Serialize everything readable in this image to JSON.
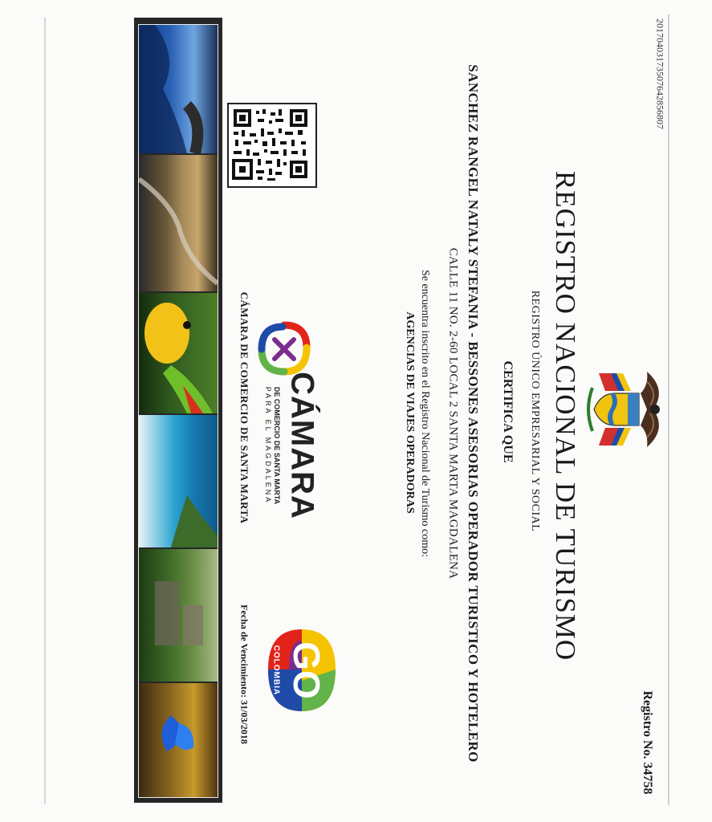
{
  "doc_id": "20170403173507642856807",
  "title": "REGISTRO NACIONAL DE TURISMO",
  "subtitle": "REGISTRO ÚNICO EMPRESARIAL Y SOCIAL",
  "certifica": "CERTIFICA QUE",
  "name": "SANCHEZ RANGEL NATALY STEFANIA - BESSONES ASESORIAS OPERADOR TURISTICO Y HOTELERO",
  "address": "CALLE 11 NO. 2-60 LOCAL 2 SANTA MARTA MAGDALENA",
  "inscrito": "Se encuentra inscrito en el Registro Nacional de Turismo como:",
  "category": "AGENCIAS DE VIAJES OPERADORAS",
  "registro": "Registro No. 34758",
  "fecha": "Fecha de Vencimiento: 31/03/2018",
  "camara": {
    "logo_word": "CÁMARA",
    "logo_sub1": "DE COMERCIO DE SANTA MARTA",
    "logo_sub2": "PARA EL MAGDALENA",
    "name": "CÁMARA DE COMERCIO DE SANTA MARTA"
  },
  "go_logo": {
    "word": "GO",
    "country": "COLOMBIA"
  },
  "icons": [
    "coat-of-arms-icon",
    "qr-code",
    "camara-logo",
    "colombia-brand-logo"
  ],
  "colors": {
    "ink": "#1a1a1a",
    "strip_frame": "#262626",
    "go_yellow": "#f5c400",
    "go_red": "#e2231a",
    "go_blue": "#1f4aa8",
    "go_green": "#62b34a",
    "go_purple": "#7b2d8e"
  }
}
